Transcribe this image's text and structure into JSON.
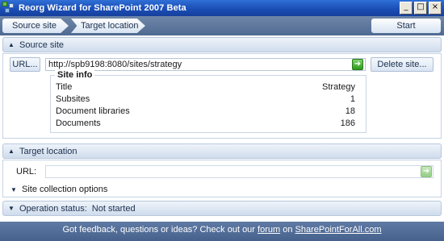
{
  "window": {
    "title": "Reorg Wizard for SharePoint 2007 Beta",
    "minimize": "_",
    "maximize": "□",
    "close": "×"
  },
  "breadcrumb": {
    "steps": [
      "Source site",
      "Target location"
    ],
    "start_label": "Start"
  },
  "source_site": {
    "header": "Source site",
    "url_button": "URL...",
    "url_value": "http://spb9198:8080/sites/strategy",
    "delete_button": "Delete site...",
    "site_info": {
      "legend": "Site info",
      "rows": [
        {
          "label": "Title",
          "value": "Strategy"
        },
        {
          "label": "Subsites",
          "value": "1"
        },
        {
          "label": "Document libraries",
          "value": "18"
        },
        {
          "label": "Documents",
          "value": "186"
        }
      ]
    }
  },
  "target_location": {
    "header": "Target location",
    "url_label": "URL:",
    "url_value": "",
    "collection_options": "Site collection options"
  },
  "operation_status": {
    "label": "Operation status:",
    "value": "Not started"
  },
  "footer": {
    "prefix": "Got feedback, questions or ideas? Check out our ",
    "forum_link": "forum",
    "middle": " on ",
    "site_link": "SharePointForAll.com"
  },
  "icons": {
    "expanded": "▲",
    "collapsed": "▼",
    "go": "➜"
  }
}
